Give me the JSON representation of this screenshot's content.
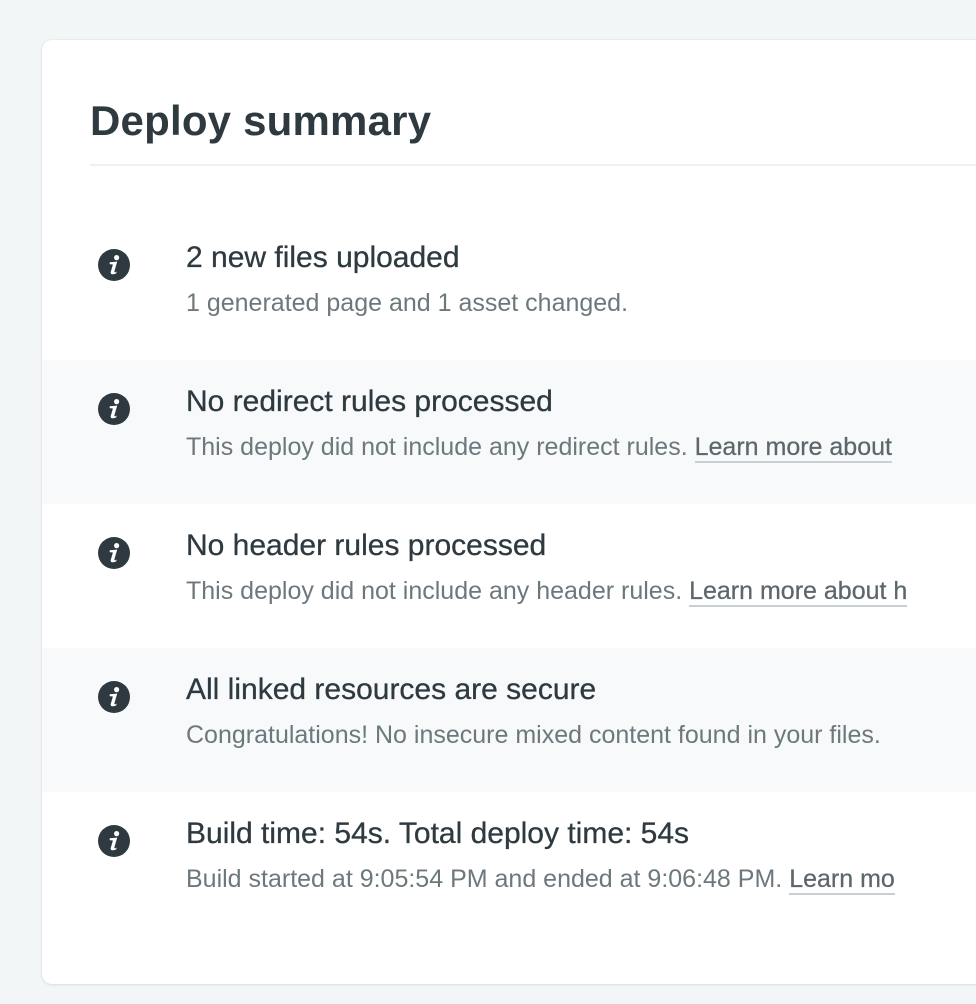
{
  "header": {
    "title": "Deploy summary"
  },
  "items": [
    {
      "icon": "info-icon",
      "title": "2 new files uploaded",
      "description": "1 generated page and 1 asset changed.",
      "link": ""
    },
    {
      "icon": "info-icon",
      "title": "No redirect rules processed",
      "description": "This deploy did not include any redirect rules. ",
      "link": "Learn more about"
    },
    {
      "icon": "info-icon",
      "title": "No header rules processed",
      "description": "This deploy did not include any header rules. ",
      "link": "Learn more about h"
    },
    {
      "icon": "info-icon",
      "title": "All linked resources are secure",
      "description": "Congratulations! No insecure mixed content found in your files.",
      "link": ""
    },
    {
      "icon": "info-icon",
      "title": "Build time: 54s. Total deploy time: 54s",
      "description": "Build started at 9:05:54 PM and ended at 9:06:48 PM. ",
      "link": "Learn mo"
    }
  ],
  "colors": {
    "background": "#f3f6f7",
    "card": "#ffffff",
    "row_shade": "#f7f9fa",
    "text_primary": "#2e3a40",
    "text_secondary": "#6d787d",
    "icon_fill": "#2e3a40"
  }
}
